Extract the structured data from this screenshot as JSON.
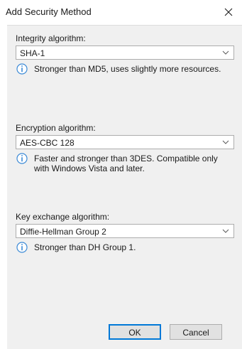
{
  "window": {
    "title": "Add Security Method",
    "close_label": "✕"
  },
  "integrity": {
    "label": "Integrity algorithm:",
    "value": "SHA-1",
    "info": "Stronger than MD5, uses slightly more resources."
  },
  "encryption": {
    "label": "Encryption algorithm:",
    "value": "AES-CBC 128",
    "info": "Faster and stronger than 3DES. Compatible only with Windows Vista and later."
  },
  "key_exchange": {
    "label": "Key exchange algorithm:",
    "value": "Diffie-Hellman Group 2",
    "info": "Stronger than DH Group 1."
  },
  "buttons": {
    "ok": "OK",
    "cancel": "Cancel"
  },
  "colors": {
    "panel_background": "#f0f0f0",
    "info_icon": "#3c8ad6",
    "default_button_border": "#0078d7"
  },
  "icons": {
    "close": "close-icon",
    "dropdown": "chevron-down-icon",
    "info": "info-icon"
  }
}
